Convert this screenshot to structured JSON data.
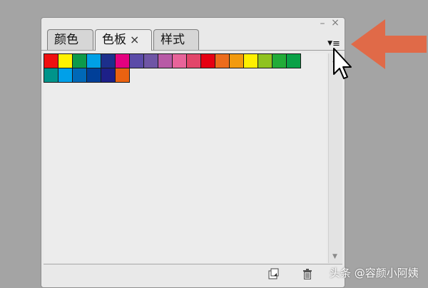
{
  "window": {
    "minimize_label": "–",
    "close_label": "×"
  },
  "tabs": [
    {
      "label": "颜色"
    },
    {
      "label": "色板",
      "close_label": "×",
      "active": true
    },
    {
      "label": "样式"
    }
  ],
  "panel_menu": {
    "icon": "panel-menu-icon",
    "triangle": "▼",
    "lines": "≡"
  },
  "swatches": {
    "row1": [
      "#ef1010",
      "#fff200",
      "#0d9a4a",
      "#00a0e6",
      "#1c2f8c",
      "#e4007f",
      "#5b4ba8",
      "#6f55a5",
      "#b85aa6",
      "#e8649a",
      "#e2466a",
      "#e60012",
      "#ec6c1b",
      "#f29a0e",
      "#fff000",
      "#8fc31f",
      "#22ac38",
      "#0aa147"
    ],
    "row2": [
      "#00948a",
      "#00a0e9",
      "#0068b7",
      "#003f98",
      "#1d2088",
      "#ea6211"
    ]
  },
  "scrollbar": {
    "up_icon": "▲",
    "down_icon": "▼"
  },
  "footer": {
    "new_swatch_icon": "new-swatch-icon",
    "delete_icon": "trash-icon"
  },
  "watermark": {
    "text": "头条 @容颜小阿姨"
  },
  "colors": {
    "arrow": "#e06a48",
    "panel_bg": "#e9e9e9",
    "background": "#a4a4a4"
  }
}
